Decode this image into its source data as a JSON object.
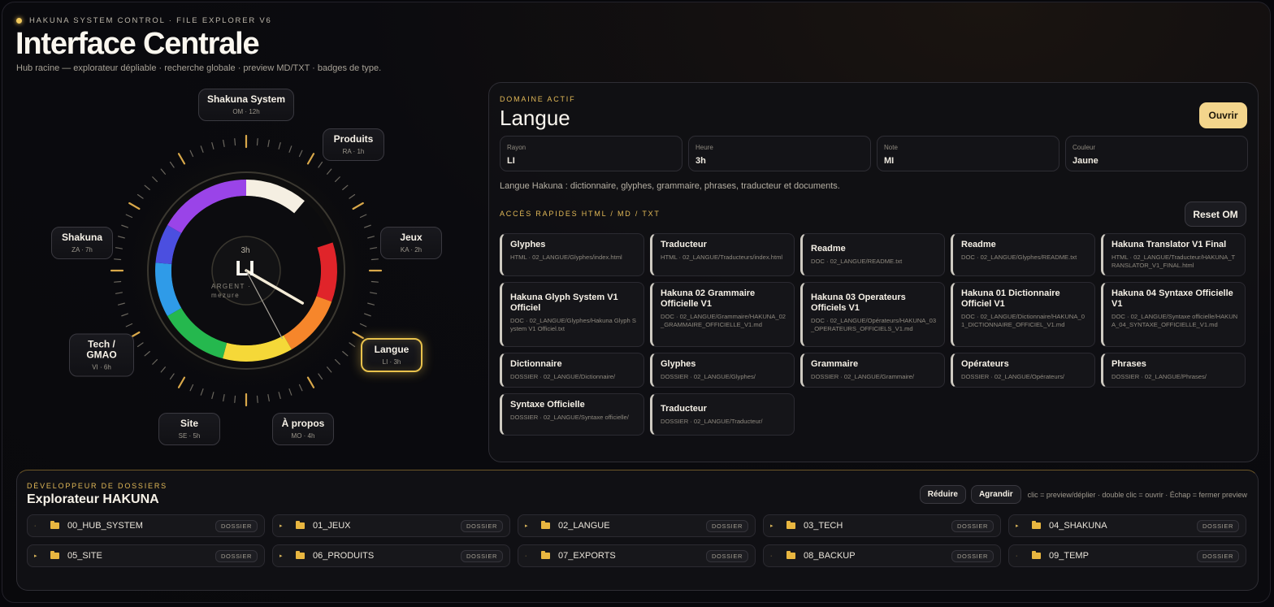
{
  "header": {
    "kicker": "HAKUNA SYSTEM CONTROL · FILE EXPLORER V6",
    "title": "Interface Centrale",
    "subtitle": "Hub racine — explorateur dépliable · recherche globale · preview MD/TXT · badges de type."
  },
  "dial": {
    "center_hour": "3h",
    "center_code": "LI",
    "center_note_1": "ARGENT ·",
    "center_note_2": "mezure",
    "nodes": [
      {
        "label": "Shakuna System",
        "sub": "OM · 12h"
      },
      {
        "label": "Produits",
        "sub": "RA · 1h"
      },
      {
        "label": "Jeux",
        "sub": "KA · 2h"
      },
      {
        "label": "Langue",
        "sub": "LI · 3h"
      },
      {
        "label": "À propos",
        "sub": "MO · 4h"
      },
      {
        "label": "Site",
        "sub": "SE · 5h"
      },
      {
        "label": "Tech / GMAO",
        "sub": "VI · 6h"
      },
      {
        "label": "Shakuna",
        "sub": "ZA · 7h"
      }
    ],
    "ring_colors": [
      "#f5efe2",
      "#0c0c0e",
      "#e0242a",
      "#f6862b",
      "#f5d838",
      "#25b84e",
      "#2f9be8",
      "#4b4fe0",
      "#9a44e8"
    ],
    "accent": "#e9c24c"
  },
  "domain": {
    "kicker": "DOMAINE ACTIF",
    "title": "Langue",
    "open_label": "Ouvrir",
    "fields": [
      {
        "label": "Rayon",
        "value": "LI"
      },
      {
        "label": "Heure",
        "value": "3h"
      },
      {
        "label": "Note",
        "value": "MI"
      },
      {
        "label": "Couleur",
        "value": "Jaune"
      }
    ],
    "description": "Langue Hakuna : dictionnaire, glyphes, grammaire, phrases, traducteur et documents.",
    "quick_kicker": "ACCÈS RAPIDES HTML / MD / TXT",
    "reset_label": "Reset OM",
    "cards": [
      {
        "title": "Glyphes",
        "path": "HTML · 02_LANGUE/Glyphes/index.html"
      },
      {
        "title": "Traducteur",
        "path": "HTML · 02_LANGUE/Traducteurs/index.html"
      },
      {
        "title": "Readme",
        "path": "DOC · 02_LANGUE/README.txt"
      },
      {
        "title": "Readme",
        "path": "DOC · 02_LANGUE/Glyphes/README.txt"
      },
      {
        "title": "Hakuna Translator V1 Final",
        "path": "HTML · 02_LANGUE/Traducteur/HAKUNA_TRANSLATOR_V1_FINAL.html"
      },
      {
        "title": "Hakuna Glyph System V1 Officiel",
        "path": "DOC · 02_LANGUE/Glyphes/Hakuna Glyph System V1 Officiel.txt"
      },
      {
        "title": "Hakuna 02 Grammaire Officielle V1",
        "path": "DOC · 02_LANGUE/Grammaire/HAKUNA_02_GRAMMAIRE_OFFICIELLE_V1.md"
      },
      {
        "title": "Hakuna 03 Operateurs Officiels V1",
        "path": "DOC · 02_LANGUE/Opérateurs/HAKUNA_03_OPERATEURS_OFFICIELS_V1.md"
      },
      {
        "title": "Hakuna 01 Dictionnaire Officiel V1",
        "path": "DOC · 02_LANGUE/Dictionnaire/HAKUNA_01_DICTIONNAIRE_OFFICIEL_V1.md"
      },
      {
        "title": "Hakuna 04 Syntaxe Officielle V1",
        "path": "DOC · 02_LANGUE/Syntaxe officielle/HAKUNA_04_SYNTAXE_OFFICIELLE_V1.md"
      },
      {
        "title": "Dictionnaire",
        "path": "DOSSIER · 02_LANGUE/Dictionnaire/"
      },
      {
        "title": "Glyphes",
        "path": "DOSSIER · 02_LANGUE/Glyphes/"
      },
      {
        "title": "Grammaire",
        "path": "DOSSIER · 02_LANGUE/Grammaire/"
      },
      {
        "title": "Opérateurs",
        "path": "DOSSIER · 02_LANGUE/Opérateurs/"
      },
      {
        "title": "Phrases",
        "path": "DOSSIER · 02_LANGUE/Phrases/"
      },
      {
        "title": "Syntaxe Officielle",
        "path": "DOSSIER · 02_LANGUE/Syntaxe officielle/"
      },
      {
        "title": "Traducteur",
        "path": "DOSSIER · 02_LANGUE/Traducteur/"
      }
    ]
  },
  "explorer": {
    "kicker": "DÉVELOPPEUR DE DOSSIERS",
    "title": "Explorateur HAKUNA",
    "reduce_label": "Réduire",
    "expand_label": "Agrandir",
    "hint": "clic = preview/déplier · double clic = ouvrir · Échap = fermer preview",
    "rows": [
      {
        "name": "00_HUB_SYSTEM",
        "badge": "DOSSIER",
        "caret": "·"
      },
      {
        "name": "01_JEUX",
        "badge": "DOSSIER",
        "caret": "▸"
      },
      {
        "name": "02_LANGUE",
        "badge": "DOSSIER",
        "caret": "▸"
      },
      {
        "name": "03_TECH",
        "badge": "DOSSIER",
        "caret": "▸"
      },
      {
        "name": "04_SHAKUNA",
        "badge": "DOSSIER",
        "caret": "▸"
      },
      {
        "name": "05_SITE",
        "badge": "DOSSIER",
        "caret": "▸"
      },
      {
        "name": "06_PRODUITS",
        "badge": "DOSSIER",
        "caret": "▸"
      },
      {
        "name": "07_EXPORTS",
        "badge": "DOSSIER",
        "caret": "·"
      },
      {
        "name": "08_BACKUP",
        "badge": "DOSSIER",
        "caret": "·"
      },
      {
        "name": "09_TEMP",
        "badge": "DOSSIER",
        "caret": "·"
      }
    ]
  }
}
